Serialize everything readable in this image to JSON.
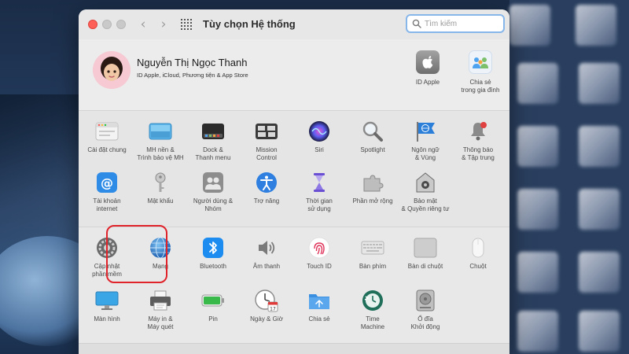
{
  "window": {
    "title": "Tùy chọn Hệ thống",
    "search_placeholder": "Tìm kiếm"
  },
  "account": {
    "name": "Nguyễn Thị Ngọc Thanh",
    "subtitle": "ID Apple, iCloud, Phương tiện & App Store",
    "items": [
      {
        "line1": "ID Apple",
        "line2": "",
        "icon": "apple-id-icon",
        "color": "#8a8a8a"
      },
      {
        "line1": "Chia sẻ",
        "line2": "trong gia đình",
        "icon": "family-sharing-icon",
        "color": "#4da3ef"
      }
    ]
  },
  "section1": [
    {
      "line1": "Cài đặt chung",
      "line2": "",
      "icon": "general-icon",
      "color": "#d9d9d9"
    },
    {
      "line1": "MH nền &",
      "line2": "Trình bảo vệ MH",
      "icon": "desktop-screensaver-icon",
      "color": "#5ab3e8"
    },
    {
      "line1": "Dock &",
      "line2": "Thanh menu",
      "icon": "dock-icon",
      "color": "#2b2b2b"
    },
    {
      "line1": "Mission",
      "line2": "Control",
      "icon": "mission-control-icon",
      "color": "#3a3a3a"
    },
    {
      "line1": "Siri",
      "line2": "",
      "icon": "siri-icon",
      "color": "#6a4ce0"
    },
    {
      "line1": "Spotlight",
      "line2": "",
      "icon": "spotlight-icon",
      "color": "#9a9a9a"
    },
    {
      "line1": "Ngôn ngữ",
      "line2": "& Vùng",
      "icon": "language-region-icon",
      "color": "#2b7fd9"
    },
    {
      "line1": "Thông báo",
      "line2": "& Tập trung",
      "icon": "notifications-icon",
      "color": "#e04040"
    },
    {
      "line1": "Tài khoản",
      "line2": "internet",
      "icon": "internet-accounts-icon",
      "color": "#2e8be6"
    },
    {
      "line1": "Mật khẩu",
      "line2": "",
      "icon": "passwords-icon",
      "color": "#a8a8a8"
    },
    {
      "line1": "Người dùng &",
      "line2": "Nhóm",
      "icon": "users-groups-icon",
      "color": "#6e6e6e"
    },
    {
      "line1": "Trợ năng",
      "line2": "",
      "icon": "accessibility-icon",
      "color": "#2e7fe0"
    },
    {
      "line1": "Thời gian",
      "line2": "sử dụng",
      "icon": "screen-time-icon",
      "color": "#6a4fd2"
    },
    {
      "line1": "Phần mở rộng",
      "line2": "",
      "icon": "extensions-icon",
      "color": "#a9a9a9"
    },
    {
      "line1": "Bảo mật",
      "line2": "& Quyền riêng tư",
      "icon": "security-privacy-icon",
      "color": "#6b6b6b"
    }
  ],
  "section2": [
    {
      "line1": "Cập nhật",
      "line2": "phần mềm",
      "icon": "software-update-icon",
      "color": "#6a6a6a"
    },
    {
      "line1": "Mạng",
      "line2": "",
      "icon": "network-icon",
      "color": "#2f7fd1"
    },
    {
      "line1": "Bluetooth",
      "line2": "",
      "icon": "bluetooth-icon",
      "color": "#1d8cf0"
    },
    {
      "line1": "Âm thanh",
      "line2": "",
      "icon": "sound-icon",
      "color": "#8a8a8a"
    },
    {
      "line1": "Touch ID",
      "line2": "",
      "icon": "touch-id-icon",
      "color": "#e0335a"
    },
    {
      "line1": "Bàn phím",
      "line2": "",
      "icon": "keyboard-icon",
      "color": "#cfcfcf"
    },
    {
      "line1": "Bàn di chuột",
      "line2": "",
      "icon": "trackpad-icon",
      "color": "#c4c4c4"
    },
    {
      "line1": "Chuột",
      "line2": "",
      "icon": "mouse-icon",
      "color": "#f2f2f2"
    },
    {
      "line1": "Màn hình",
      "line2": "",
      "icon": "displays-icon",
      "color": "#3aa6e6"
    },
    {
      "line1": "Máy in &",
      "line2": "Máy quét",
      "icon": "printers-icon",
      "color": "#5c5c5c"
    },
    {
      "line1": "Pin",
      "line2": "",
      "icon": "battery-icon",
      "color": "#38b94a"
    },
    {
      "line1": "Ngày & Giờ",
      "line2": "",
      "icon": "date-time-icon",
      "color": "#e03b3b"
    },
    {
      "line1": "Chia sẻ",
      "line2": "",
      "icon": "sharing-icon",
      "color": "#3a8fe0"
    },
    {
      "line1": "Time",
      "line2": "Machine",
      "icon": "time-machine-icon",
      "color": "#1f6f5a"
    },
    {
      "line1": "Ổ đĩa",
      "line2": "Khởi động",
      "icon": "startup-disk-icon",
      "color": "#8c8c8c"
    }
  ],
  "highlight": {
    "target": "Bluetooth",
    "color": "#e0232b"
  }
}
